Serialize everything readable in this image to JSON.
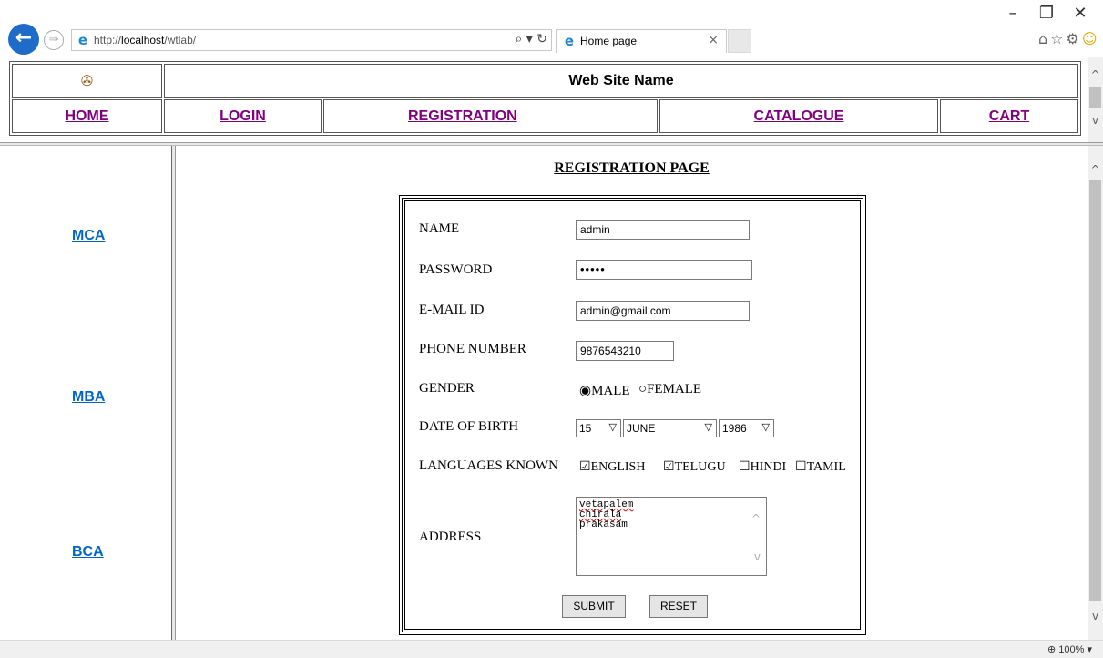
{
  "browser": {
    "url_prefix": "http://",
    "url_host": "localhost",
    "url_path": "/wtlab/",
    "tab_title": "Home page",
    "zoom": "100%",
    "icons": [
      "back-icon",
      "forward-icon",
      "ie-icon",
      "search-icon",
      "refresh-icon",
      "home-icon",
      "favorites-icon",
      "settings-icon",
      "smiley-icon"
    ]
  },
  "header": {
    "site_name": "Web Site Name",
    "nav": [
      "HOME",
      "LOGIN",
      "REGISTRATION",
      "CATALOGUE",
      "CART"
    ]
  },
  "sidebar": {
    "items": [
      "MCA",
      "MBA",
      "BCA"
    ]
  },
  "form": {
    "title": "REGISTRATION PAGE",
    "labels": {
      "name": "NAME",
      "password": "PASSWORD",
      "email": "E-MAIL ID",
      "phone": "PHONE NUMBER",
      "gender": "GENDER",
      "dob": "DATE OF BIRTH",
      "languages": "LANGUAGES KNOWN",
      "address": "ADDRESS"
    },
    "values": {
      "name": "admin",
      "password": "•••••",
      "email": "admin@gmail.com",
      "phone": "9876543210",
      "dob_day": "15",
      "dob_month": "JUNE",
      "dob_year": "1986",
      "address": [
        "vetapalem",
        "chirala",
        "prakasam"
      ]
    },
    "gender_options": [
      {
        "label": "MALE",
        "checked": true
      },
      {
        "label": "FEMALE",
        "checked": false
      }
    ],
    "languages": [
      {
        "label": "ENGLISH",
        "checked": true
      },
      {
        "label": "TELUGU",
        "checked": true
      },
      {
        "label": "HINDI",
        "checked": false
      },
      {
        "label": "TAMIL",
        "checked": false
      }
    ],
    "submit_label": "SUBMIT",
    "reset_label": "RESET"
  }
}
